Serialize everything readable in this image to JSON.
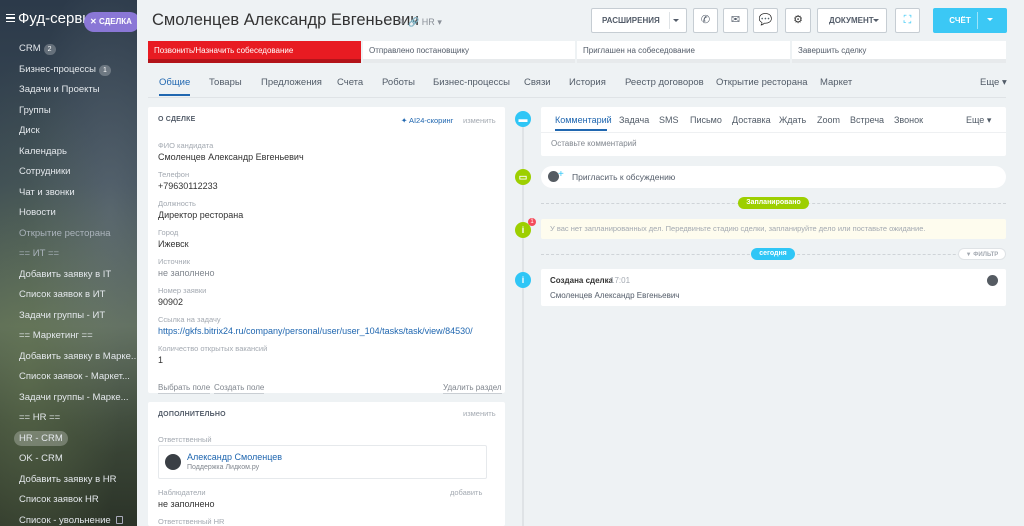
{
  "sidebar": {
    "brand": "Фуд-сервис",
    "deal_pill": "СДЕЛКА",
    "items": [
      {
        "label": "CRM",
        "count": "2"
      },
      {
        "label": "Бизнес-процессы",
        "count": "1"
      },
      {
        "label": "Задачи и Проекты"
      },
      {
        "label": "Группы"
      },
      {
        "label": "Диск"
      },
      {
        "label": "Календарь"
      },
      {
        "label": "Сотрудники"
      },
      {
        "label": "Чат и звонки"
      },
      {
        "label": "Новости"
      },
      {
        "label": "Открытие ресторана"
      },
      {
        "label": "== ИТ =="
      },
      {
        "label": "Добавить заявку в IT"
      },
      {
        "label": "Список заявок в ИТ"
      },
      {
        "label": "Задачи группы - ИТ"
      },
      {
        "label": "== Маркетинг =="
      },
      {
        "label": "Добавить заявку в Марке..."
      },
      {
        "label": "Список заявок - Маркет..."
      },
      {
        "label": "Задачи группы - Марке..."
      },
      {
        "label": "== HR =="
      },
      {
        "label": "HR - CRM"
      },
      {
        "label": "OK - CRM"
      },
      {
        "label": "Добавить заявку в HR"
      },
      {
        "label": "Список заявок HR"
      },
      {
        "label": "Список - увольнение"
      }
    ]
  },
  "header": {
    "title": "Смоленцев Александр  Евгеньевич",
    "category": "HR",
    "extensions_label": "РАСШИРЕНИЯ",
    "document_label": "ДОКУМЕНТ",
    "score_label": "СЧЁТ"
  },
  "stages": [
    {
      "label": "Позвонить/Назначить собеседование"
    },
    {
      "label": "Отправлено постановщику"
    },
    {
      "label": "Приглашен на собеседование"
    },
    {
      "label": "Завершить сделку"
    }
  ],
  "tabs": [
    "Общие",
    "Товары",
    "Предложения",
    "Счета",
    "Роботы",
    "Бизнес-процессы",
    "Связи",
    "История",
    "Реестр договоров",
    "Открытие ресторана",
    "Маркет",
    "Еще"
  ],
  "about": {
    "header": "О СДЕЛКЕ",
    "ai_label": "AI24-скоринг",
    "edit_label": "изменить",
    "fields": [
      {
        "label": "ФИО кандидата",
        "value": "Смоленцев Александр Евгеньевич"
      },
      {
        "label": "Телефон",
        "value": "+79630112233"
      },
      {
        "label": "Должность",
        "value": "Директор ресторана"
      },
      {
        "label": "Город",
        "value": "Ижевск"
      },
      {
        "label": "Источник",
        "value": "не заполнено"
      },
      {
        "label": "Номер заявки",
        "value": "90902"
      },
      {
        "label": "Ссылка на задачу",
        "value": "https://gkfs.bitrix24.ru/company/personal/user/user_104/tasks/task/view/84530/"
      },
      {
        "label": "Количество открытых вакансий",
        "value": "1"
      }
    ],
    "select_field": "Выбрать поле",
    "create_field": "Создать поле",
    "delete_section": "Удалить раздел"
  },
  "extra": {
    "header": "ДОПОЛНИТЕЛЬНО",
    "edit_label": "изменить",
    "responsible_label": "Ответственный",
    "responsible_name": "Александр Смоленцев",
    "responsible_position": "Поддержка Лидком.ру",
    "observers_label": "Наблюдатели",
    "observers_add": "добавить",
    "observers_value": "не заполнено",
    "responsible_hr_label": "Ответственный HR"
  },
  "timeline": {
    "tabs": [
      "Комментарий",
      "Задача",
      "SMS",
      "Письмо",
      "Доставка",
      "Ждать",
      "Zoom",
      "Встреча",
      "Звонок",
      "Еще"
    ],
    "comment_placeholder": "Оставьте комментарий",
    "invite": "Пригласить к обсуждению",
    "planned_pill": "Запланировано",
    "planned_badge": "1",
    "planned_text": "У вас нет запланированных дел. Передвиньте стадию сделки, запланируйте дело или поставьте ожидание.",
    "today_pill": "сегодня",
    "filter": "ФИЛЬТР",
    "event_title": "Создана сделка",
    "event_time": "17:01",
    "event_text": "Смоленцев Александр Евгеньевич"
  },
  "colors": {
    "accent": "#2067b0",
    "stage_current": "#e81b22",
    "score_button": "#3bc8f5",
    "planned_green": "#9dcf00",
    "today_blue": "#2fc6f6",
    "info_blue": "#2fc6f6"
  }
}
